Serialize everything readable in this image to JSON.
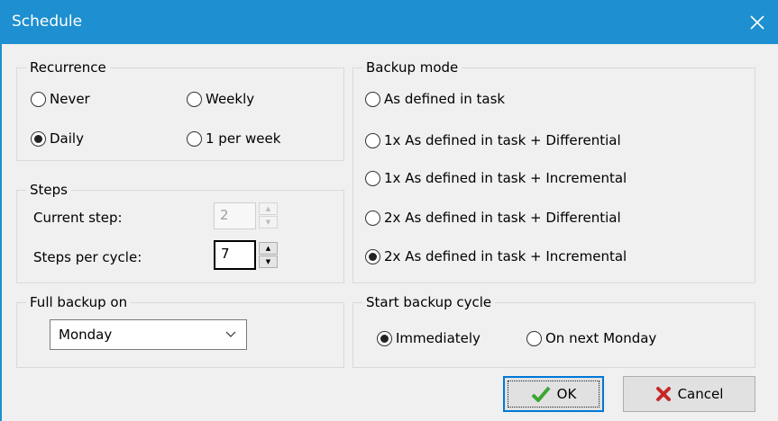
{
  "window": {
    "title": "Schedule"
  },
  "recurrence": {
    "legend": "Recurrence",
    "options": [
      {
        "label": "Never",
        "checked": false
      },
      {
        "label": "Weekly",
        "checked": false
      },
      {
        "label": "Daily",
        "checked": true
      },
      {
        "label": "1 per week",
        "checked": false
      }
    ]
  },
  "steps": {
    "legend": "Steps",
    "current_label": "Current step:",
    "current_value": "2",
    "per_cycle_label": "Steps per cycle:",
    "per_cycle_value": "7"
  },
  "full_backup": {
    "legend": "Full backup on",
    "selected": "Monday"
  },
  "backup_mode": {
    "legend": "Backup mode",
    "options": [
      {
        "label": "As defined in task",
        "checked": false
      },
      {
        "label": "1x As defined in task + Differential",
        "checked": false
      },
      {
        "label": "1x As defined in task + Incremental",
        "checked": false
      },
      {
        "label": "2x As defined in task + Differential",
        "checked": false
      },
      {
        "label": "2x As defined in task + Incremental",
        "checked": true
      }
    ]
  },
  "start_cycle": {
    "legend": "Start backup cycle",
    "options": [
      {
        "label": "Immediately",
        "checked": true
      },
      {
        "label": "On next Monday",
        "checked": false
      }
    ]
  },
  "buttons": {
    "ok": "OK",
    "cancel": "Cancel"
  },
  "icons": {
    "close": "close-icon",
    "ok": "checkmark-icon",
    "cancel": "x-mark-icon",
    "dropdown": "chevron-down-icon"
  },
  "colors": {
    "titlebar": "#1e8fd0",
    "ok_check": "#3aa631",
    "cancel_x": "#c62828",
    "focus_border": "#0078d7"
  }
}
